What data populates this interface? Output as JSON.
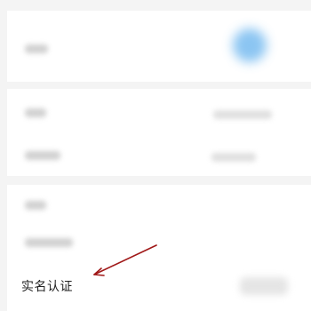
{
  "settings": {
    "real_name_label": "实名认证"
  },
  "colors": {
    "avatar": "#6fb7ef",
    "annotation_arrow": "#a01818"
  }
}
